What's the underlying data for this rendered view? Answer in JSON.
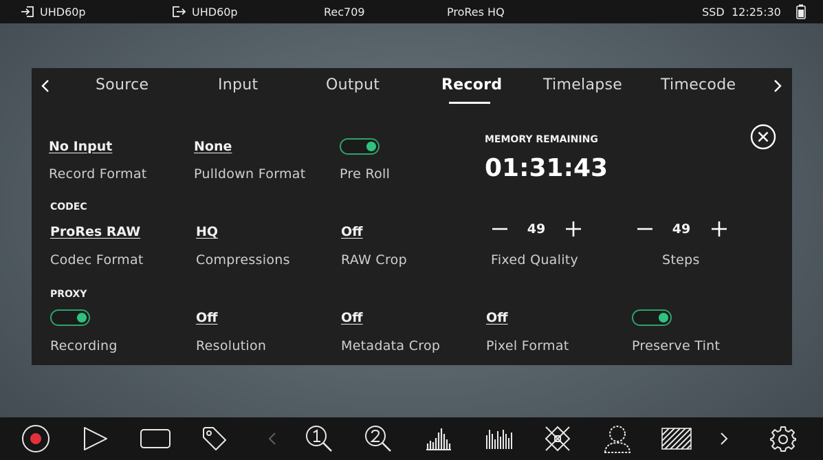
{
  "status_bar": {
    "input_format": "UHD60p",
    "output_format": "UHD60p",
    "color_space": "Rec709",
    "codec": "ProRes HQ",
    "media": "SSD",
    "time": "12:25:30"
  },
  "tabs": [
    {
      "label": "Source"
    },
    {
      "label": "Input"
    },
    {
      "label": "Output"
    },
    {
      "label": "Record",
      "active": true
    },
    {
      "label": "Timelapse"
    },
    {
      "label": "Timecode"
    }
  ],
  "record": {
    "record_format": {
      "value": "No Input",
      "label": "Record Format"
    },
    "pulldown_format": {
      "value": "None",
      "label": "Pulldown Format"
    },
    "pre_roll": {
      "on": true,
      "label": "Pre Roll"
    },
    "memory_remaining": {
      "title": "MEMORY REMAINING",
      "value": "01:31:43"
    }
  },
  "codec": {
    "section_title": "CODEC",
    "codec_format": {
      "value": "ProRes RAW",
      "label": "Codec Format"
    },
    "compressions": {
      "value": "HQ",
      "label": "Compressions"
    },
    "raw_crop": {
      "value": "Off",
      "label": "RAW Crop"
    },
    "fixed_quality": {
      "value": "49",
      "label": "Fixed Quality"
    },
    "steps": {
      "value": "49",
      "label": "Steps"
    }
  },
  "proxy": {
    "section_title": "PROXY",
    "recording": {
      "on": true,
      "label": "Recording"
    },
    "resolution": {
      "value": "Off",
      "label": "Resolution"
    },
    "metadata_crop": {
      "value": "Off",
      "label": "Metadata Crop"
    },
    "pixel_format": {
      "value": "Off",
      "label": "Pixel Format"
    },
    "preserve_tint": {
      "on": true,
      "label": "Preserve Tint"
    }
  },
  "colors": {
    "toggle_accent": "#2ec27e",
    "record_red": "#e0313b",
    "panel_bg": "#202020",
    "bar_bg": "#161616"
  },
  "icons": {
    "top": [
      "input-icon",
      "output-icon",
      "battery-icon"
    ],
    "bottom": [
      "record-icon",
      "play-icon",
      "stop-icon",
      "tag-icon",
      "chevron-left-icon",
      "zoom-1-icon",
      "zoom-2-icon",
      "waveform-icon",
      "histogram-icon",
      "vectorscope-icon",
      "false-color-icon",
      "zebra-icon",
      "chevron-right-icon",
      "settings-icon"
    ]
  }
}
